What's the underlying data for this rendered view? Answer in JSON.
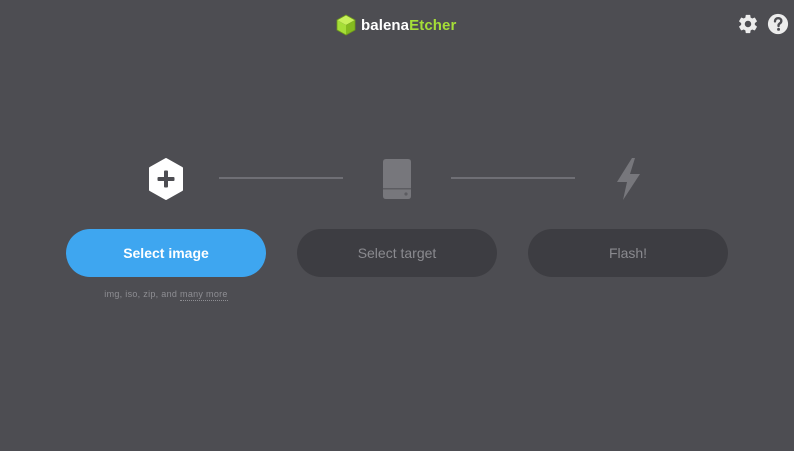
{
  "app": {
    "brand_part1": "balena",
    "brand_part2": "Etcher",
    "brand_color": "#a5de37",
    "background_color": "#4d4d52"
  },
  "header": {
    "settings_icon": "gear-icon",
    "help_icon": "question-circle-icon"
  },
  "steps": [
    {
      "icon": "plus-hexagon-icon",
      "button_label": "Select image",
      "enabled": true,
      "button_color": "#3ea6f0"
    },
    {
      "icon": "drive-icon",
      "button_label": "Select target",
      "enabled": false
    },
    {
      "icon": "lightning-bolt-icon",
      "button_label": "Flash!",
      "enabled": false
    }
  ],
  "image_formats": {
    "text": "img, iso, zip, and",
    "more_link": "many more"
  }
}
